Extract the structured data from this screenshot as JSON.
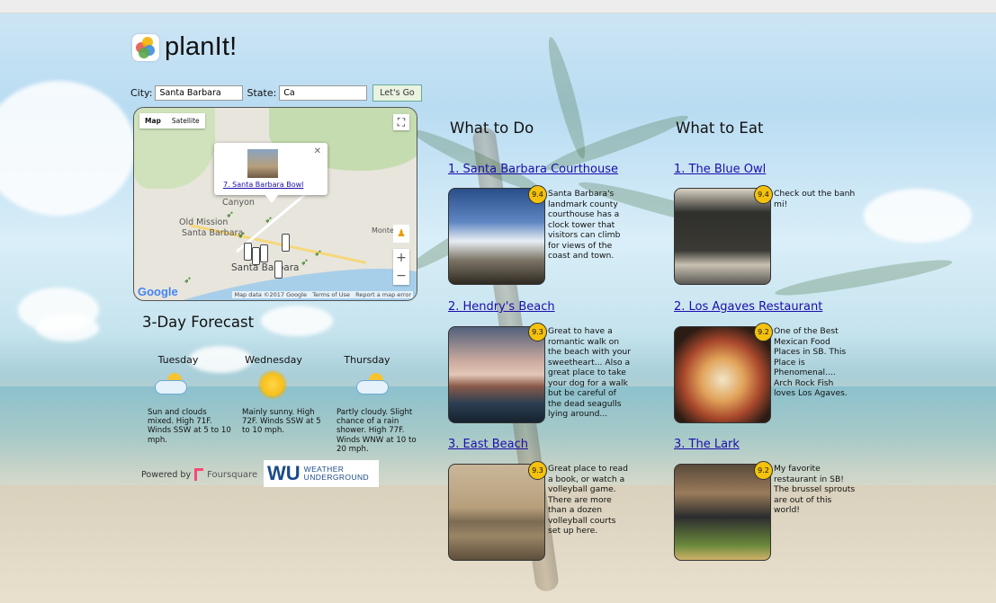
{
  "app": {
    "name": "planIt!"
  },
  "search": {
    "city_label": "City:",
    "city_value": "Santa Barbara",
    "state_label": "State:",
    "state_value": "Ca",
    "submit_label": "Let's Go"
  },
  "map": {
    "type_map": "Map",
    "type_satellite": "Satellite",
    "labels": [
      "Canyon",
      "Old Mission",
      "Santa Barbara",
      "Santa Barbara",
      "Monte"
    ],
    "info_link": "7. Santa Barbara Bowl",
    "attribution": [
      "Map data ©2017 Google",
      "Terms of Use",
      "Report a map error"
    ],
    "google_text": "Google",
    "zoom_in": "+",
    "zoom_out": "−"
  },
  "forecast": {
    "title": "3-Day Forecast",
    "days": [
      {
        "name": "Tuesday",
        "icon": "partly-cloudy-icon",
        "desc": "Sun and clouds mixed. High 71F. Winds SSW at 5 to 10 mph."
      },
      {
        "name": "Wednesday",
        "icon": "sun-icon",
        "desc": "Mainly sunny. High 72F. Winds SSW at 5 to 10 mph."
      },
      {
        "name": "Thursday",
        "icon": "partly-cloudy-icon",
        "desc": "Partly cloudy. Slight chance of a rain shower. High 77F. Winds WNW at 10 to 20 mph."
      }
    ]
  },
  "footer": {
    "powered_by": "Powered by",
    "foursquare": "Foursquare",
    "wu_mark": "WU",
    "wu_text": [
      "WEATHER",
      "UNDERGROUND"
    ]
  },
  "todo": {
    "title": "What to Do",
    "items": [
      {
        "title": "1. Santa Barbara Courthouse",
        "rating": "9.4",
        "desc": "Santa Barbara's landmark county courthouse has a clock tower that visitors can climb for views of the coast and town."
      },
      {
        "title": "2. Hendry's Beach",
        "rating": "9.3",
        "desc": "Great to have a romantic walk on the beach with your sweetheart... Also a great place to take your dog for a walk but be careful of the dead seagulls lying around..."
      },
      {
        "title": "3. East Beach",
        "rating": "9.3",
        "desc": "Great place to read a book, or watch a volleyball game. There are more than a dozen volleyball courts set up here."
      }
    ]
  },
  "eat": {
    "title": "What to Eat",
    "items": [
      {
        "title": "1. The Blue Owl",
        "rating": "9.4",
        "desc": "Check out the banh mi!"
      },
      {
        "title": "2. Los Agaves Restaurant",
        "rating": "9.2",
        "desc": "One of the Best Mexican Food Places in SB. This Place is Phenomenal.... Arch Rock Fish loves Los Agaves."
      },
      {
        "title": "3. The Lark",
        "rating": "9.2",
        "desc": "My favorite restaurant in SB! The brussel sprouts are out of this world!"
      }
    ]
  }
}
